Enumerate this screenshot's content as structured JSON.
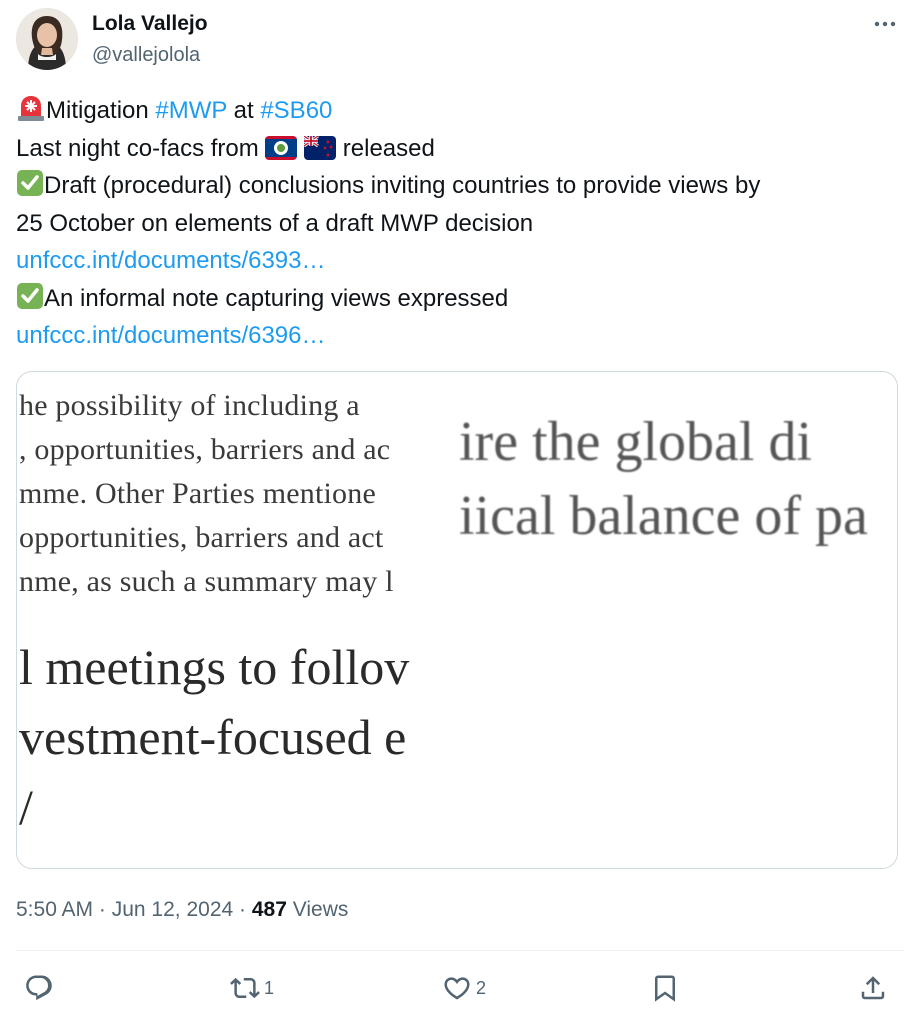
{
  "author": {
    "display_name": "Lola Vallejo",
    "handle": "@vallejolola"
  },
  "tweet": {
    "line1": {
      "emoji": "🚨",
      "text_a": "Mitigation ",
      "hashtag_1": "#MWP",
      "text_b": " at ",
      "hashtag_2": "#SB60"
    },
    "line2": {
      "text_a": "Last night co-facs from ",
      "flags": [
        "Belize flag",
        "New Zealand flag"
      ],
      "text_b": " released"
    },
    "line3": {
      "emoji": "✅",
      "text": "Draft (procedural) conclusions inviting countries to provide views by"
    },
    "line4": {
      "text": "25 October on elements of a draft MWP decision"
    },
    "link_1": "unfccc.int/documents/6393…",
    "line6": {
      "emoji": "✅",
      "text": "An informal note capturing views expressed"
    },
    "link_2": "unfccc.int/documents/6396…"
  },
  "media": {
    "left_lines_small": [
      "he possibility of including a",
      ", opportunities, barriers and ac",
      "mme. Other Parties mentione",
      " opportunities, barriers and act",
      "nme, as such a summary may l"
    ],
    "left_lines_big": [
      "l meetings to follov",
      "vestment-focused e",
      "/"
    ],
    "right_lines": [
      "ire  the  global  di",
      "iical balance of pa"
    ]
  },
  "meta": {
    "time": "5:50 AM",
    "separator": " · ",
    "date": "Jun 12, 2024",
    "views_count": "487",
    "views_label": " Views"
  },
  "actions": {
    "reply_count": "",
    "retweet_count": "1",
    "like_count": "2"
  },
  "icons": [
    "more-icon",
    "reply-icon",
    "retweet-icon",
    "like-icon",
    "bookmark-icon",
    "share-icon"
  ],
  "colors": {
    "link": "#1d9bf0",
    "secondary": "#536471",
    "text": "#0f1419"
  }
}
